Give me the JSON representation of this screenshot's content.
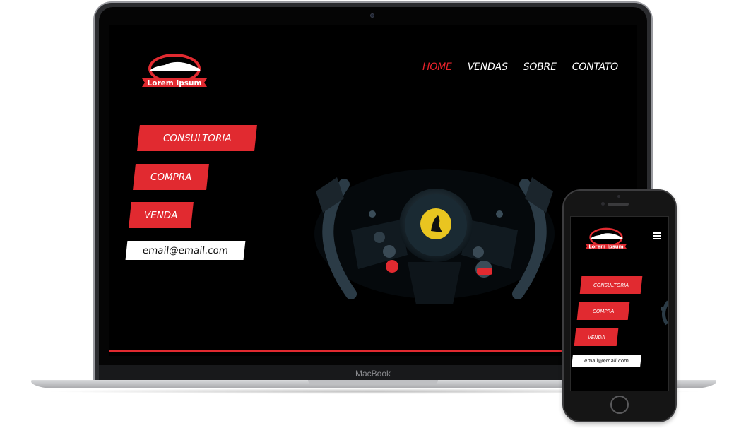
{
  "laptop": {
    "brand_label": "MacBook"
  },
  "site": {
    "logo_text": "Lorem Ipsum",
    "nav": [
      {
        "label": "HOME",
        "active": true
      },
      {
        "label": "VENDAS",
        "active": false
      },
      {
        "label": "SOBRE",
        "active": false
      },
      {
        "label": "CONTATO",
        "active": false
      }
    ],
    "buttons": {
      "consultoria": "CONSULTORIA",
      "compra": "COMPRA",
      "venda": "VENDA"
    },
    "email": {
      "value": "email@email.com"
    },
    "hero_image_icon": "steering-wheel-icon"
  },
  "colors": {
    "accent": "#e12a30",
    "background": "#000000",
    "text": "#ffffff"
  }
}
